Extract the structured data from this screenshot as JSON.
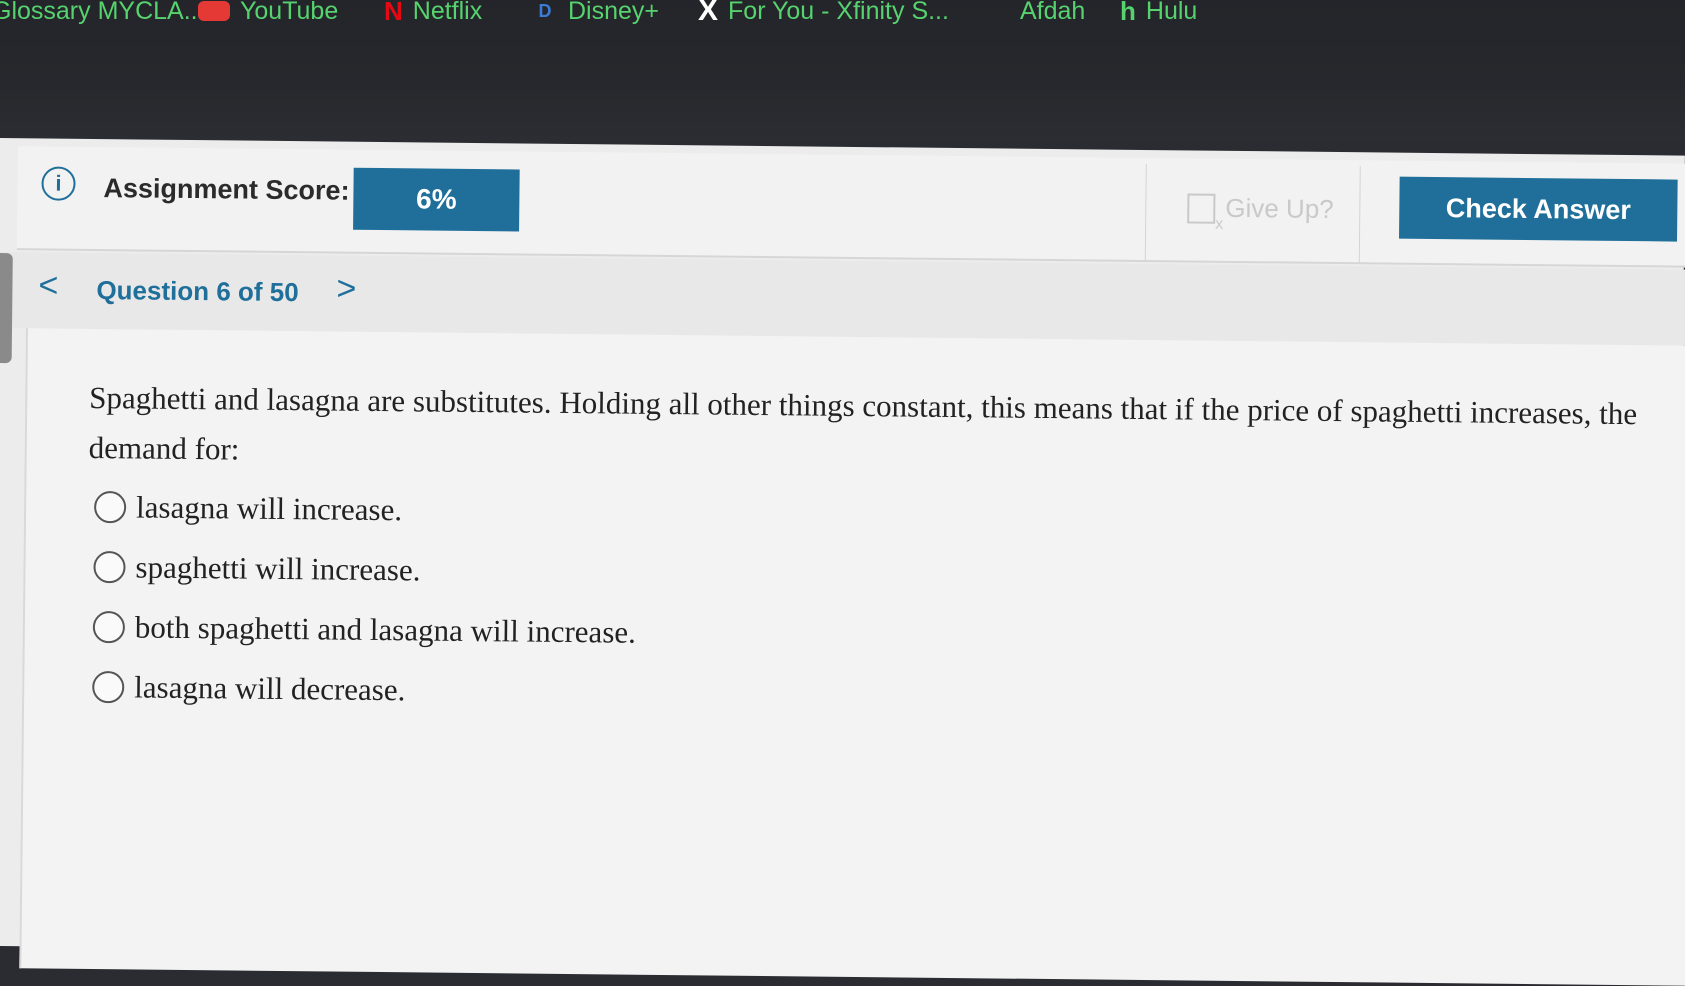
{
  "browser": {
    "bookmarks": [
      {
        "label": "Glossary MYCLA...",
        "icon": "bookmark-icon"
      },
      {
        "label": "YouTube",
        "icon": "youtube-icon"
      },
      {
        "label": "Netflix",
        "icon": "netflix-icon"
      },
      {
        "label": "Disney+",
        "icon": "disney-icon"
      },
      {
        "label": "For You - Xfinity S...",
        "icon": "xfinity-icon"
      },
      {
        "label": "Afdah",
        "icon": ""
      },
      {
        "label": "Hulu",
        "icon": "hulu-icon"
      }
    ]
  },
  "header": {
    "score_label": "Assignment Score:",
    "score_value": "6%",
    "give_up_label": "Give Up?",
    "check_answer_label": "Check Answer"
  },
  "nav": {
    "question_counter": "Question 6 of 50",
    "prev_glyph": "<",
    "next_glyph": ">"
  },
  "question": {
    "text": "Spaghetti and lasagna are substitutes. Holding all other things constant, this means that if the price of spaghetti increases, the demand for:",
    "options": [
      "lasagna will increase.",
      "spaghetti will increase.",
      "both spaghetti and lasagna will increase.",
      "lasagna will decrease."
    ]
  },
  "colors": {
    "accent": "#1f6f9a",
    "bookmark_text": "#56d36e",
    "browser_bg": "#26282d",
    "page_bg": "#ececec"
  }
}
